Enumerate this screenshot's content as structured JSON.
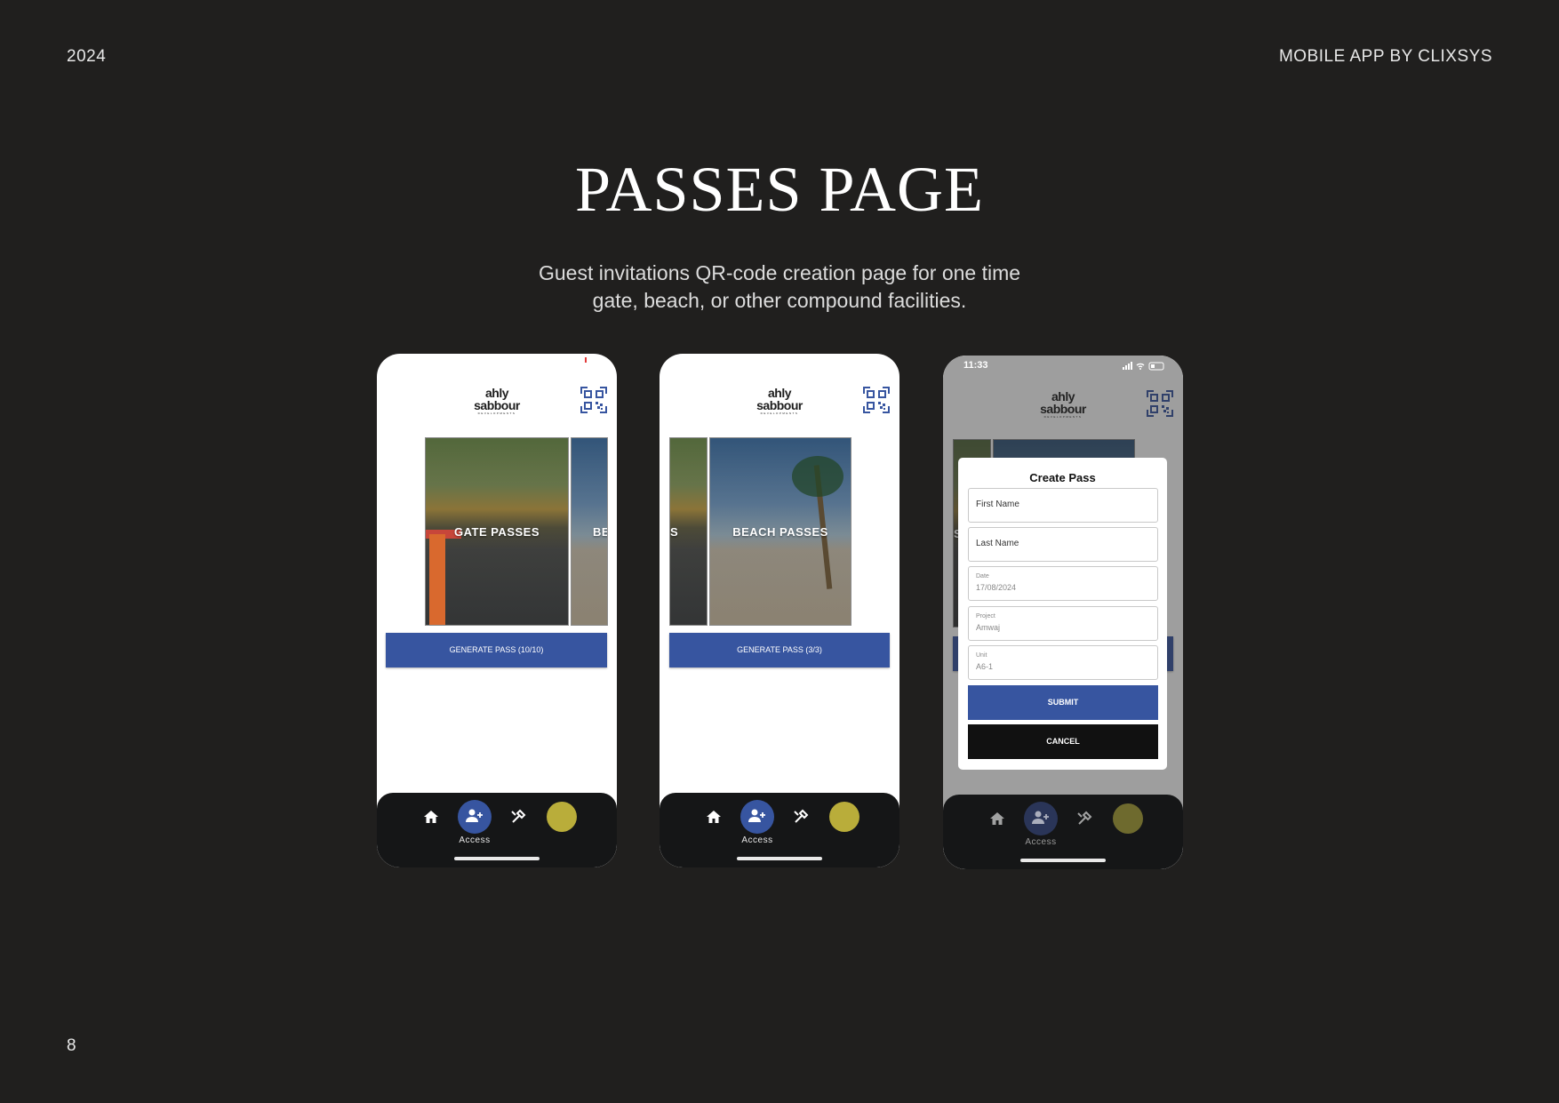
{
  "header": {
    "year": "2024",
    "brand": "MOBILE APP BY CLIXSYS"
  },
  "page_number": "8",
  "title": "PASSES PAGE",
  "subtitle": {
    "line1": "Guest invitations QR-code creation page for one time",
    "line2": "gate, beach, or other compound facilities."
  },
  "app": {
    "logo": {
      "line1": "ahly",
      "line2": "sabbour",
      "line3": "DEVELOPMENTS"
    },
    "tabbar": {
      "access_label": "Access"
    }
  },
  "phone1": {
    "card_main": "GATE PASSES",
    "card_peek": "BE",
    "generate_button": "GENERATE PASS (10/10)"
  },
  "phone2": {
    "card_peek": "S",
    "card_main": "BEACH PASSES",
    "generate_button": "GENERATE PASS (3/3)"
  },
  "phone3": {
    "status_time": "11:33",
    "card_peek": "S",
    "modal": {
      "title": "Create Pass",
      "first_name_placeholder": "First Name",
      "last_name_placeholder": "Last Name",
      "date_label": "Date",
      "date_value": "17/08/2024",
      "project_label": "Project",
      "project_value": "Amwaj",
      "unit_label": "Unit",
      "unit_value": "A6-1",
      "submit": "SUBMIT",
      "cancel": "CANCEL"
    }
  },
  "colors": {
    "background": "#201f1e",
    "primary": "#3755a0",
    "tabbar": "#151617",
    "avatar": "#b9ad3a"
  }
}
